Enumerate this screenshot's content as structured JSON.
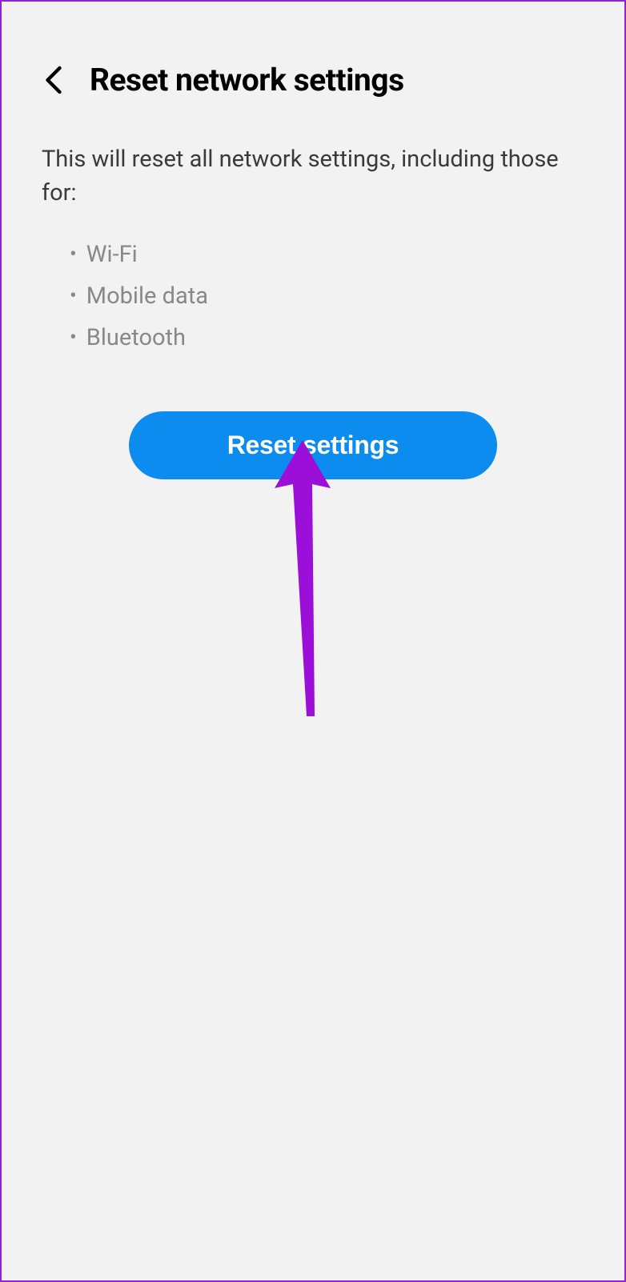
{
  "header": {
    "title": "Reset network settings"
  },
  "description": "This will reset all network settings, including those for:",
  "bullets": [
    "Wi-Fi",
    "Mobile data",
    "Bluetooth"
  ],
  "button": {
    "label": "Reset settings"
  },
  "colors": {
    "primary": "#0d8cf0",
    "annotation": "#9b0fd8"
  }
}
